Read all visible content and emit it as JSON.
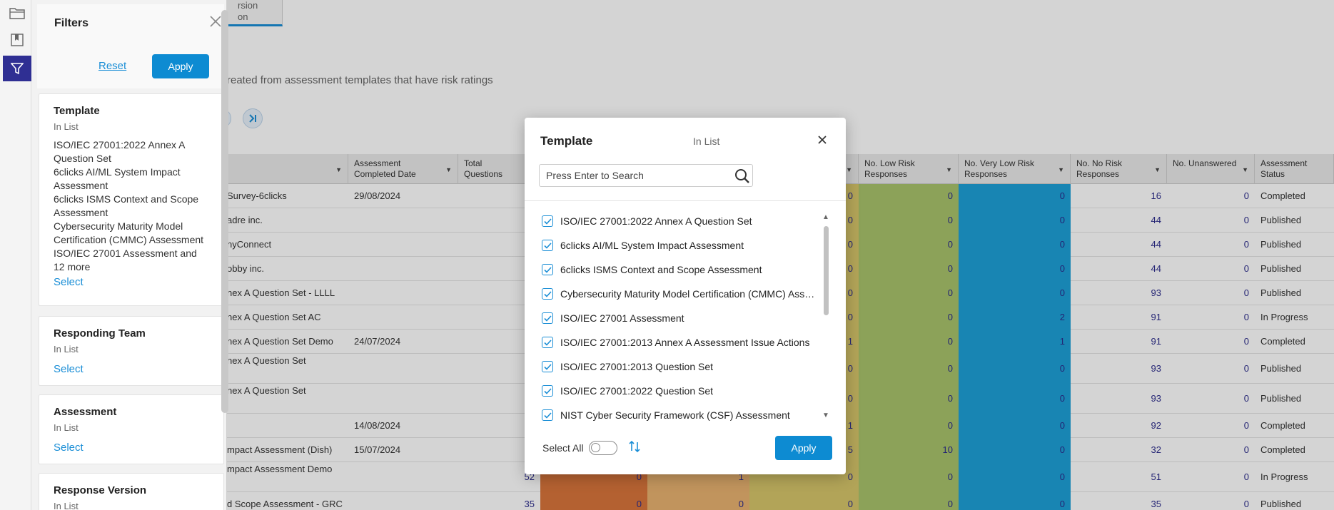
{
  "background": {
    "tab_label_line1": "rsion",
    "tab_label_line2": "on",
    "description": "reated from assessment templates that have risk ratings",
    "table": {
      "headers": [
        {
          "label": "",
          "sortable": true
        },
        {
          "label": "Assessment Completed Date",
          "sortable": true
        },
        {
          "label": "Total Questions",
          "sortable": false
        },
        {
          "label": "",
          "sortable": true
        },
        {
          "label": "No. Low Risk Responses",
          "sortable": true
        },
        {
          "label": "No. Very Low Risk Responses",
          "sortable": true
        },
        {
          "label": "No. No Risk Responses",
          "sortable": true
        },
        {
          "label": "No. Unanswered",
          "sortable": true
        },
        {
          "label": "Assessment Status",
          "sortable": false
        }
      ],
      "rows": [
        {
          "name": "Survey-6clicks",
          "date": "29/08/2024",
          "total": "",
          "high": "",
          "medium": "",
          "lowmed": "0",
          "low": "0",
          "vlow": "0",
          "norisk": "16",
          "unanswered": "0",
          "status": "Completed"
        },
        {
          "name": "adre inc.",
          "date": "",
          "total": "",
          "high": "",
          "medium": "",
          "lowmed": "0",
          "low": "0",
          "vlow": "0",
          "norisk": "44",
          "unanswered": "0",
          "status": "Published"
        },
        {
          "name": "nyConnect",
          "date": "",
          "total": "",
          "high": "",
          "medium": "",
          "lowmed": "0",
          "low": "0",
          "vlow": "0",
          "norisk": "44",
          "unanswered": "0",
          "status": "Published"
        },
        {
          "name": "obby inc.",
          "date": "",
          "total": "",
          "high": "",
          "medium": "",
          "lowmed": "0",
          "low": "0",
          "vlow": "0",
          "norisk": "44",
          "unanswered": "0",
          "status": "Published"
        },
        {
          "name": "nex A Question Set - LLLL",
          "date": "",
          "total": "",
          "high": "",
          "medium": "",
          "lowmed": "0",
          "low": "0",
          "vlow": "0",
          "norisk": "93",
          "unanswered": "0",
          "status": "Published"
        },
        {
          "name": "nex A Question Set AC",
          "date": "",
          "total": "",
          "high": "",
          "medium": "",
          "lowmed": "0",
          "low": "0",
          "vlow": "2",
          "norisk": "91",
          "unanswered": "0",
          "status": "In Progress"
        },
        {
          "name": "nex A Question Set Demo",
          "date": "24/07/2024",
          "total": "",
          "high": "",
          "medium": "",
          "lowmed": "1",
          "low": "0",
          "vlow": "1",
          "norisk": "91",
          "unanswered": "0",
          "status": "Completed"
        },
        {
          "name": "nex A Question Set",
          "date": "",
          "total": "",
          "high": "",
          "medium": "",
          "lowmed": "0",
          "low": "0",
          "vlow": "0",
          "norisk": "93",
          "unanswered": "0",
          "status": "Published"
        },
        {
          "name": "nex A Question Set",
          "date": "",
          "total": "",
          "high": "",
          "medium": "",
          "lowmed": "0",
          "low": "0",
          "vlow": "0",
          "norisk": "93",
          "unanswered": "0",
          "status": "Published"
        },
        {
          "name": "",
          "date": "14/08/2024",
          "total": "",
          "high": "",
          "medium": "",
          "lowmed": "1",
          "low": "0",
          "vlow": "0",
          "norisk": "92",
          "unanswered": "0",
          "status": "Completed"
        },
        {
          "name": "mpact Assessment (Dish)",
          "date": "15/07/2024",
          "total": "",
          "high": "",
          "medium": "",
          "lowmed": "5",
          "low": "10",
          "vlow": "0",
          "norisk": "32",
          "unanswered": "0",
          "status": "Completed"
        },
        {
          "name": "mpact Assessment Demo",
          "date": "",
          "total": "52",
          "high": "0",
          "medium": "1",
          "lowmed": "0",
          "low": "0",
          "vlow": "0",
          "norisk": "51",
          "unanswered": "0",
          "status": "In Progress"
        },
        {
          "name": "d Scope Assessment - GRC",
          "date": "",
          "total": "35",
          "high": "0",
          "medium": "0",
          "lowmed": "0",
          "low": "0",
          "vlow": "0",
          "norisk": "35",
          "unanswered": "0",
          "status": "Published"
        }
      ]
    }
  },
  "filter_panel": {
    "title": "Filters",
    "reset_label": "Reset",
    "apply_label": "Apply",
    "sections": [
      {
        "title": "Template",
        "subtitle": "In List",
        "values": [
          "ISO/IEC 27001:2022 Annex A Question Set",
          "6clicks AI/ML System Impact Assessment",
          "6clicks ISMS Context and Scope Assessment",
          "Cybersecurity Maturity Model Certification (CMMC) Assessment",
          "ISO/IEC 27001 Assessment and 12 more"
        ],
        "select_label": "Select"
      },
      {
        "title": "Responding Team",
        "subtitle": "In List",
        "select_label": "Select"
      },
      {
        "title": "Assessment",
        "subtitle": "In List",
        "select_label": "Select"
      },
      {
        "title": "Response Version",
        "subtitle": "In List"
      }
    ]
  },
  "modal": {
    "title": "Template",
    "subtitle": "In List",
    "search_placeholder": "Press Enter to Search",
    "items": [
      {
        "label": "ISO/IEC 27001:2022 Annex A Question Set",
        "checked": true
      },
      {
        "label": "6clicks AI/ML System Impact Assessment",
        "checked": true
      },
      {
        "label": "6clicks ISMS Context and Scope Assessment",
        "checked": true
      },
      {
        "label": "Cybersecurity Maturity Model Certification (CMMC) Assessment",
        "checked": true
      },
      {
        "label": "ISO/IEC 27001 Assessment",
        "checked": true
      },
      {
        "label": "ISO/IEC 27001:2013 Annex A Assessment Issue Actions",
        "checked": true
      },
      {
        "label": "ISO/IEC 27001:2013 Question Set",
        "checked": true
      },
      {
        "label": "ISO/IEC 27001:2022 Question Set",
        "checked": true
      },
      {
        "label": "NIST Cyber Security Framework (CSF) Assessment",
        "checked": true
      }
    ],
    "select_all_label": "Select All",
    "select_all_on": false,
    "apply_label": "Apply"
  },
  "colors": {
    "accent": "#0d8bd2",
    "nav_active": "#2f2f93",
    "risk_high": "#d9753c",
    "risk_medium": "#e8b270",
    "risk_low_medium": "#d6c66a",
    "risk_low": "#a9c36b",
    "risk_very_low": "#1ea0d8"
  }
}
